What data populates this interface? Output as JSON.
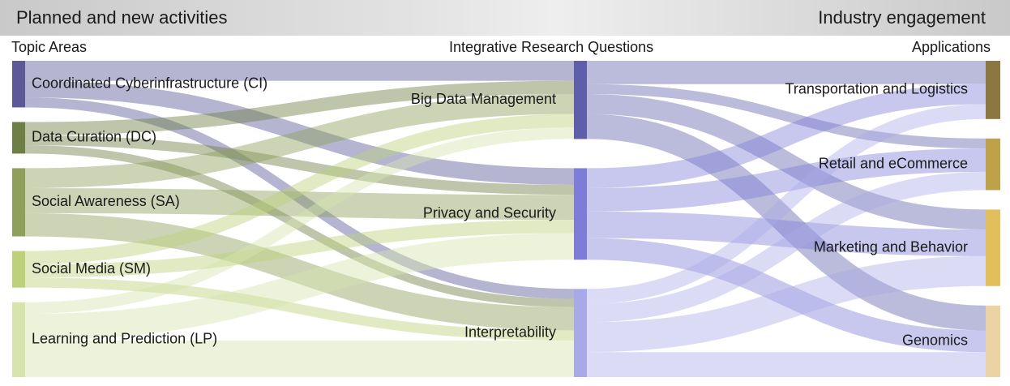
{
  "header": {
    "left_title": "Planned and new activities",
    "right_title": "Industry engagement"
  },
  "columns": {
    "left": "Topic Areas",
    "middle": "Integrative Research Questions",
    "right": "Applications"
  },
  "colors": {
    "CI": "#5a5a98",
    "DC": "#6e7f45",
    "SA": "#8fa05a",
    "SM": "#bdd17a",
    "LP": "#d8e4ae",
    "BDM": "#5e5eaa",
    "PS": "#7d7dd8",
    "INT": "#a9a9e8",
    "TL": "#8c7740",
    "RE": "#bfa14a",
    "MB": "#e3bf5c",
    "GE": "#ecd3a6"
  },
  "diagram": {
    "nodes": [
      {
        "id": "CI",
        "label": "Coordinated Cyberinfrastructure (CI)",
        "column": "left"
      },
      {
        "id": "DC",
        "label": "Data Curation (DC)",
        "column": "left"
      },
      {
        "id": "SA",
        "label": "Social Awareness (SA)",
        "column": "left"
      },
      {
        "id": "SM",
        "label": "Social Media (SM)",
        "column": "left"
      },
      {
        "id": "LP",
        "label": "Learning and Prediction (LP)",
        "column": "left"
      },
      {
        "id": "BDM",
        "label": "Big Data Management",
        "column": "middle"
      },
      {
        "id": "PS",
        "label": "Privacy and Security",
        "column": "middle"
      },
      {
        "id": "INT",
        "label": "Interpretability",
        "column": "middle"
      },
      {
        "id": "TL",
        "label": "Transportation and Logistics",
        "column": "right"
      },
      {
        "id": "RE",
        "label": "Retail and eCommerce",
        "column": "right"
      },
      {
        "id": "MB",
        "label": "Marketing and Behavior",
        "column": "right"
      },
      {
        "id": "GE",
        "label": "Genomics",
        "column": "right"
      }
    ],
    "links": [
      {
        "source": "CI",
        "target": "BDM",
        "value": 12
      },
      {
        "source": "CI",
        "target": "PS",
        "value": 10
      },
      {
        "source": "CI",
        "target": "INT",
        "value": 6
      },
      {
        "source": "DC",
        "target": "BDM",
        "value": 8
      },
      {
        "source": "DC",
        "target": "PS",
        "value": 6
      },
      {
        "source": "DC",
        "target": "INT",
        "value": 5
      },
      {
        "source": "SA",
        "target": "BDM",
        "value": 12
      },
      {
        "source": "SA",
        "target": "PS",
        "value": 15
      },
      {
        "source": "SA",
        "target": "INT",
        "value": 14
      },
      {
        "source": "SM",
        "target": "BDM",
        "value": 8
      },
      {
        "source": "SM",
        "target": "PS",
        "value": 8
      },
      {
        "source": "SM",
        "target": "INT",
        "value": 6
      },
      {
        "source": "LP",
        "target": "BDM",
        "value": 7
      },
      {
        "source": "LP",
        "target": "PS",
        "value": 16
      },
      {
        "source": "LP",
        "target": "INT",
        "value": 22
      },
      {
        "source": "BDM",
        "target": "TL",
        "value": 14
      },
      {
        "source": "BDM",
        "target": "RE",
        "value": 6
      },
      {
        "source": "BDM",
        "target": "MB",
        "value": 12
      },
      {
        "source": "BDM",
        "target": "GE",
        "value": 15
      },
      {
        "source": "PS",
        "target": "TL",
        "value": 12
      },
      {
        "source": "PS",
        "target": "RE",
        "value": 14
      },
      {
        "source": "PS",
        "target": "MB",
        "value": 16
      },
      {
        "source": "PS",
        "target": "GE",
        "value": 13
      },
      {
        "source": "INT",
        "target": "TL",
        "value": 9
      },
      {
        "source": "INT",
        "target": "RE",
        "value": 11
      },
      {
        "source": "INT",
        "target": "MB",
        "value": 18
      },
      {
        "source": "INT",
        "target": "GE",
        "value": 15
      }
    ]
  }
}
